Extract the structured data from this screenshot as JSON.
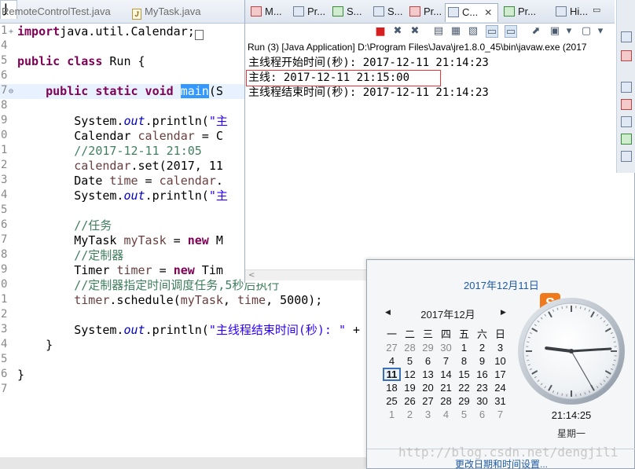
{
  "editor": {
    "tabs": [
      {
        "label": "RemoteControlTest.java"
      },
      {
        "label": "MyTask.java"
      }
    ],
    "lines": [
      {
        "num": "1",
        "fold": "+",
        "parts": [
          [
            "kw",
            "import"
          ],
          [
            "",
            "java.util.Calendar;"
          ],
          [
            "box",
            "□"
          ]
        ]
      },
      {
        "num": "4",
        "fold": "",
        "parts": []
      },
      {
        "num": "5",
        "fold": "",
        "parts": [
          [
            "kw",
            "public class"
          ],
          [
            "",
            " Run {"
          ]
        ]
      },
      {
        "num": "6",
        "fold": "",
        "parts": []
      },
      {
        "num": "7",
        "fold": "⊖",
        "current": true,
        "parts": [
          [
            "",
            "    "
          ],
          [
            "kw",
            "public static void"
          ],
          [
            "",
            " "
          ],
          [
            "sel",
            "main"
          ],
          [
            "",
            "(S"
          ]
        ]
      },
      {
        "num": "8",
        "fold": "",
        "parts": []
      },
      {
        "num": "9",
        "fold": "",
        "parts": [
          [
            "",
            "        System."
          ],
          [
            "fld",
            "out"
          ],
          [
            "",
            ".println("
          ],
          [
            "str",
            "\"主"
          ]
        ]
      },
      {
        "num": "0",
        "fold": "",
        "parts": [
          [
            "",
            "        Calendar "
          ],
          [
            "var",
            "calendar"
          ],
          [
            "",
            " = C"
          ]
        ]
      },
      {
        "num": "1",
        "fold": "",
        "parts": [
          [
            "cmt",
            "        //2017-12-11 21:05"
          ]
        ]
      },
      {
        "num": "2",
        "fold": "",
        "parts": [
          [
            "",
            "        "
          ],
          [
            "var",
            "calendar"
          ],
          [
            "",
            ".set(2017, 11"
          ]
        ]
      },
      {
        "num": "3",
        "fold": "",
        "parts": [
          [
            "",
            "        Date "
          ],
          [
            "var",
            "time"
          ],
          [
            "",
            " = "
          ],
          [
            "var",
            "calendar"
          ],
          [
            "",
            "."
          ]
        ]
      },
      {
        "num": "4",
        "fold": "",
        "parts": [
          [
            "",
            "        System."
          ],
          [
            "fld",
            "out"
          ],
          [
            "",
            ".println("
          ],
          [
            "str",
            "\"主"
          ]
        ]
      },
      {
        "num": "5",
        "fold": "",
        "parts": []
      },
      {
        "num": "6",
        "fold": "",
        "parts": [
          [
            "cmt",
            "        //任务"
          ]
        ]
      },
      {
        "num": "7",
        "fold": "",
        "parts": [
          [
            "",
            "        MyTask "
          ],
          [
            "var",
            "myTask"
          ],
          [
            "",
            " = "
          ],
          [
            "kw",
            "new"
          ],
          [
            "",
            " M"
          ]
        ]
      },
      {
        "num": "8",
        "fold": "",
        "parts": [
          [
            "cmt",
            "        //定制器"
          ]
        ]
      },
      {
        "num": "9",
        "fold": "",
        "parts": [
          [
            "",
            "        Timer "
          ],
          [
            "var",
            "timer"
          ],
          [
            "",
            " = "
          ],
          [
            "kw",
            "new"
          ],
          [
            "",
            " Tim"
          ]
        ]
      },
      {
        "num": "0",
        "fold": "",
        "parts": [
          [
            "cmt",
            "        //定制器指定时间调度任务,5秒后执行"
          ]
        ]
      },
      {
        "num": "1",
        "fold": "",
        "parts": [
          [
            "",
            "        "
          ],
          [
            "var",
            "timer"
          ],
          [
            "",
            ".schedule("
          ],
          [
            "var",
            "myTask"
          ],
          [
            "",
            ", "
          ],
          [
            "var",
            "time"
          ],
          [
            "",
            ", 5000);"
          ]
        ]
      },
      {
        "num": "2",
        "fold": "",
        "parts": []
      },
      {
        "num": "3",
        "fold": "",
        "parts": [
          [
            "",
            "        System."
          ],
          [
            "fld",
            "out"
          ],
          [
            "",
            ".println("
          ],
          [
            "str",
            "\"主线程结束时间(秒): \""
          ],
          [
            "",
            " +"
          ]
        ]
      },
      {
        "num": "4",
        "fold": "",
        "parts": [
          [
            "",
            "    }"
          ]
        ]
      },
      {
        "num": "5",
        "fold": "",
        "parts": []
      },
      {
        "num": "6",
        "fold": "",
        "parts": [
          [
            "",
            "}"
          ]
        ]
      },
      {
        "num": "7",
        "fold": "",
        "parts": []
      }
    ]
  },
  "views": {
    "tabs": [
      {
        "label": "M...",
        "icon": "markers-icon",
        "style": "red"
      },
      {
        "label": "Pr...",
        "icon": "properties-icon",
        "style": ""
      },
      {
        "label": "S...",
        "icon": "servers-icon",
        "style": "green"
      },
      {
        "label": "S...",
        "icon": "snippets-icon",
        "style": ""
      },
      {
        "label": "Pr...",
        "icon": "problems-icon",
        "style": "red"
      },
      {
        "label": "C...",
        "icon": "console-icon",
        "style": "",
        "active": true,
        "close": "✕"
      },
      {
        "label": "Pr...",
        "icon": "progress-icon",
        "style": "green"
      },
      {
        "label": "Hi...",
        "icon": "history-icon",
        "style": ""
      }
    ],
    "minimize": "▭"
  },
  "console": {
    "header": "Run (3) [Java Application] D:\\Program Files\\Java\\jre1.8.0_45\\bin\\javaw.exe (2017",
    "output": [
      "主线程开始时间(秒): 2017-12-11 21:14:23",
      "主线: 2017-12-11 21:15:00",
      "主线程结束时间(秒): 2017-12-11 21:14:23"
    ],
    "hscroll_arrow": "<"
  },
  "clock": {
    "date_link": "2017年12月11日",
    "month_label": "2017年12月",
    "prev": "◀",
    "next": "▶",
    "weekdays": [
      "一",
      "二",
      "三",
      "四",
      "五",
      "六",
      "日"
    ],
    "weeks": [
      [
        [
          "27",
          "other"
        ],
        [
          "28",
          "other"
        ],
        [
          "29",
          "other"
        ],
        [
          "30",
          "other"
        ],
        [
          "1",
          ""
        ],
        [
          "2",
          ""
        ],
        [
          "3",
          ""
        ]
      ],
      [
        [
          "4",
          ""
        ],
        [
          "5",
          ""
        ],
        [
          "6",
          ""
        ],
        [
          "7",
          ""
        ],
        [
          "8",
          ""
        ],
        [
          "9",
          ""
        ],
        [
          "10",
          ""
        ]
      ],
      [
        [
          "11",
          "today"
        ],
        [
          "12",
          ""
        ],
        [
          "13",
          ""
        ],
        [
          "14",
          ""
        ],
        [
          "15",
          ""
        ],
        [
          "16",
          ""
        ],
        [
          "17",
          ""
        ]
      ],
      [
        [
          "18",
          ""
        ],
        [
          "19",
          ""
        ],
        [
          "20",
          ""
        ],
        [
          "21",
          ""
        ],
        [
          "22",
          ""
        ],
        [
          "23",
          ""
        ],
        [
          "24",
          ""
        ]
      ],
      [
        [
          "25",
          ""
        ],
        [
          "26",
          ""
        ],
        [
          "27",
          ""
        ],
        [
          "28",
          ""
        ],
        [
          "29",
          ""
        ],
        [
          "30",
          ""
        ],
        [
          "31",
          ""
        ]
      ],
      [
        [
          "1",
          "other"
        ],
        [
          "2",
          "other"
        ],
        [
          "3",
          "other"
        ],
        [
          "4",
          "other"
        ],
        [
          "5",
          "other"
        ],
        [
          "6",
          "other"
        ],
        [
          "7",
          "other"
        ]
      ]
    ],
    "time": "21:14:25",
    "hour": 21,
    "minute": 14,
    "second": 25,
    "weekday": "星期一",
    "settings_link": "更改日期和时间设置...",
    "ime_label": "S"
  },
  "watermark": "http://blog.csdn.net/dengjili"
}
